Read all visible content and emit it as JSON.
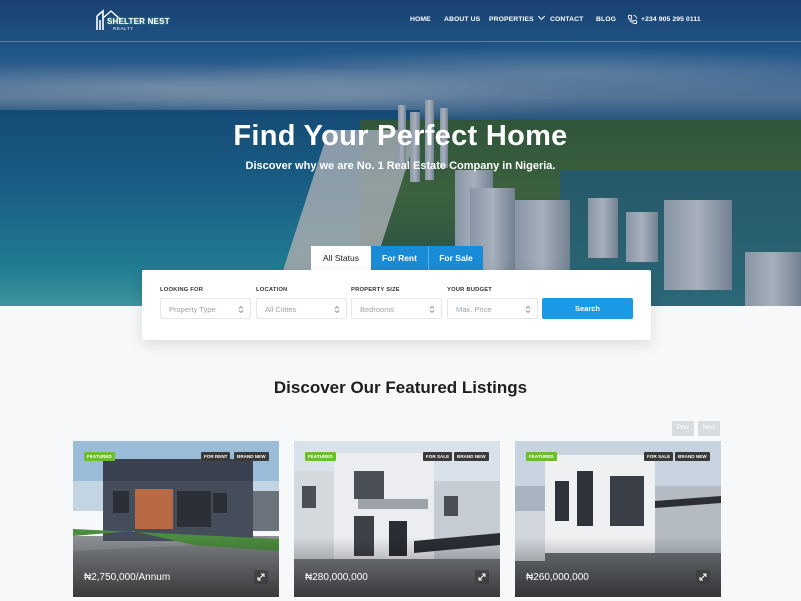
{
  "brand": {
    "name": "SHELTER NEST",
    "tagline": "REALTY"
  },
  "nav": {
    "items": [
      "HOME",
      "ABOUT US",
      "PROPERTIES",
      "CONTACT",
      "BLOG"
    ],
    "phone": "+234 905 295 0111"
  },
  "hero": {
    "title": "Find Your Perfect Home",
    "subtitle": "Discover why we are No. 1 Real Estate Company in Nigeria."
  },
  "tabs": [
    "All Status",
    "For Rent",
    "For Sale"
  ],
  "search": {
    "fields": [
      {
        "label": "LOOKING FOR",
        "value": "Property Type"
      },
      {
        "label": "LOCATION",
        "value": "All Citites"
      },
      {
        "label": "PROPERTY SIZE",
        "value": "Bedrooms"
      },
      {
        "label": "YOUR BUDGET",
        "value": "Max. Price"
      }
    ],
    "button": "Search"
  },
  "featured": {
    "title": "Discover Our Featured Listings",
    "prev": "Prev",
    "next": "Next",
    "cards": [
      {
        "badge": "FEATURED",
        "status": "FOR RENT",
        "condition": "BRAND NEW",
        "price": "₦2,750,000/Annum"
      },
      {
        "badge": "FEATURED",
        "status": "FOR SALE",
        "condition": "BRAND NEW",
        "price": "₦280,000,000"
      },
      {
        "badge": "FEATURED",
        "status": "FOR SALE",
        "condition": "BRAND NEW",
        "price": "₦260,000,000"
      }
    ]
  },
  "colors": {
    "accent": "#1a9be8",
    "featured_badge": "#6cbf2c",
    "tab_blue": "#1a8bd6"
  }
}
